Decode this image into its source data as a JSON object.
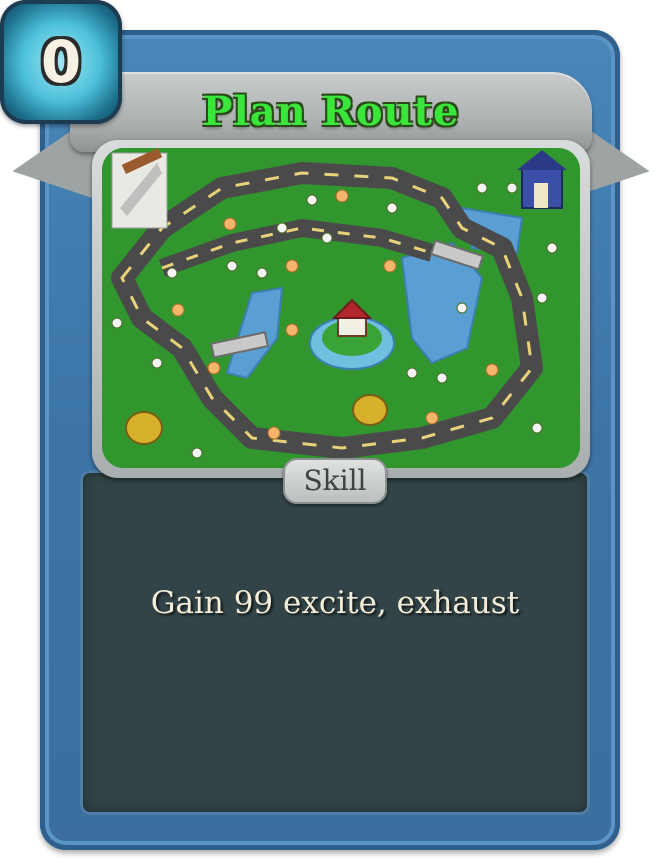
{
  "card": {
    "cost": "0",
    "title": "Plan Route",
    "type": "Skill",
    "description": "Gain 99 excite,  exhaust"
  },
  "colors": {
    "frame": "#3c74a6",
    "body": "#324447",
    "title": "#3be63b",
    "banner": "#aeb2b2",
    "gem": "#4cc0da"
  },
  "art": {
    "scene": "route-map",
    "icons": [
      "road",
      "lake",
      "bridge",
      "flower",
      "tree-stump",
      "cottage",
      "house",
      "signpost"
    ]
  }
}
